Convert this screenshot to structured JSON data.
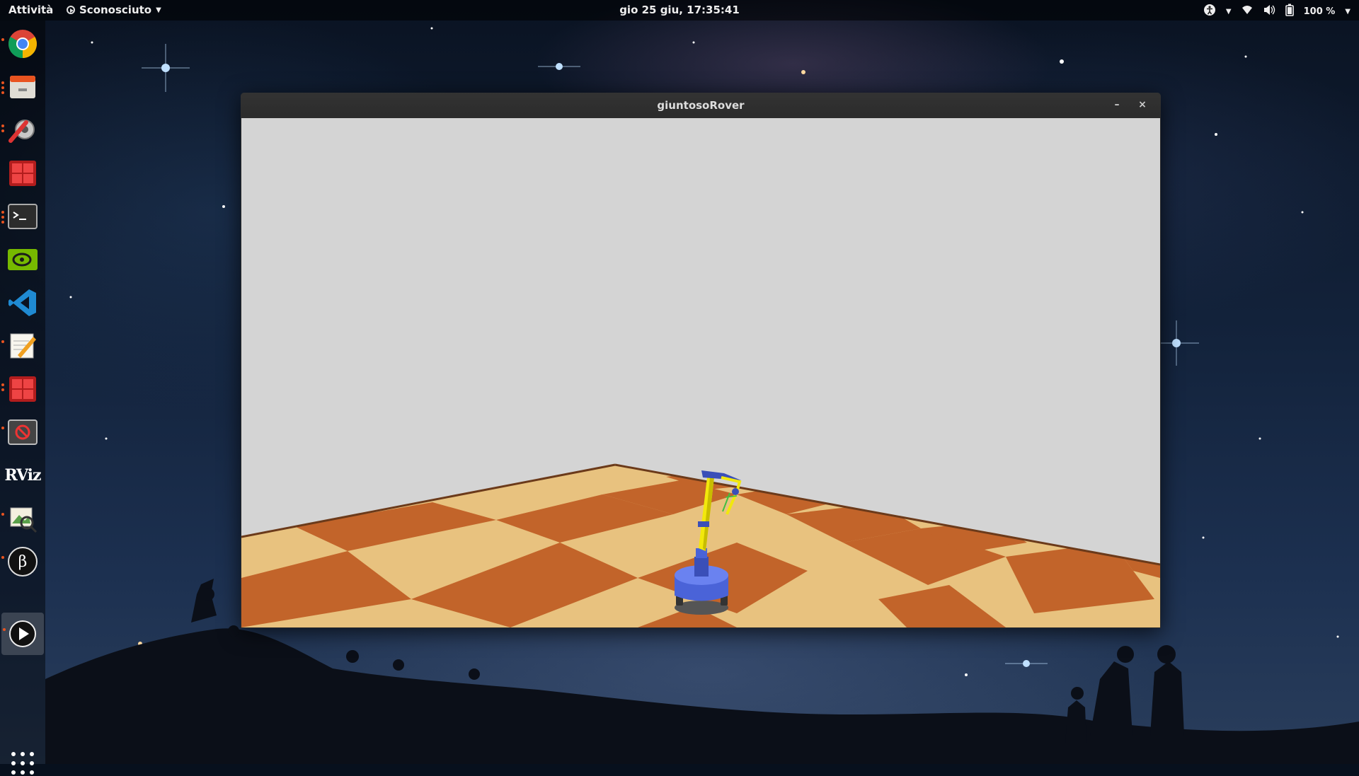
{
  "topbar": {
    "activities": "Attività",
    "app_menu": "Sconosciuto",
    "clock": "gio 25 giu, 17:35:41",
    "battery": "100 %"
  },
  "dock": {
    "items": [
      {
        "name": "chrome",
        "icon": "chrome-icon",
        "running": true
      },
      {
        "name": "files",
        "icon": "file-manager-icon",
        "running": true
      },
      {
        "name": "tools",
        "icon": "tools-icon",
        "running": true
      },
      {
        "name": "terminator-1",
        "icon": "terminator-icon",
        "running": false
      },
      {
        "name": "terminal",
        "icon": "terminal-icon",
        "running": true
      },
      {
        "name": "nvidia",
        "icon": "nvidia-icon",
        "running": false
      },
      {
        "name": "vscode",
        "icon": "vscode-icon",
        "running": false
      },
      {
        "name": "text-editor",
        "icon": "text-editor-icon",
        "running": true
      },
      {
        "name": "terminator-2",
        "icon": "terminator-icon",
        "running": true
      },
      {
        "name": "stop-app",
        "icon": "stop-app-icon",
        "running": true
      },
      {
        "name": "rviz",
        "icon": "rviz-icon",
        "running": false
      },
      {
        "name": "image-viewer",
        "icon": "image-viewer-icon",
        "running": true
      },
      {
        "name": "beta",
        "icon": "beta-icon",
        "running": true
      },
      {
        "name": "player",
        "icon": "play-icon",
        "running": true,
        "active": true
      }
    ],
    "rviz_label": "RViz",
    "beta_label": "β"
  },
  "window": {
    "title": "giuntosoRover",
    "minimize": "–",
    "close": "×"
  },
  "colors": {
    "sky": "#d4d4d4",
    "tile_light": "#e8c27f",
    "tile_dark": "#c2642a",
    "robot_base": "#4a63d8",
    "robot_arm": "#f2e80c"
  }
}
